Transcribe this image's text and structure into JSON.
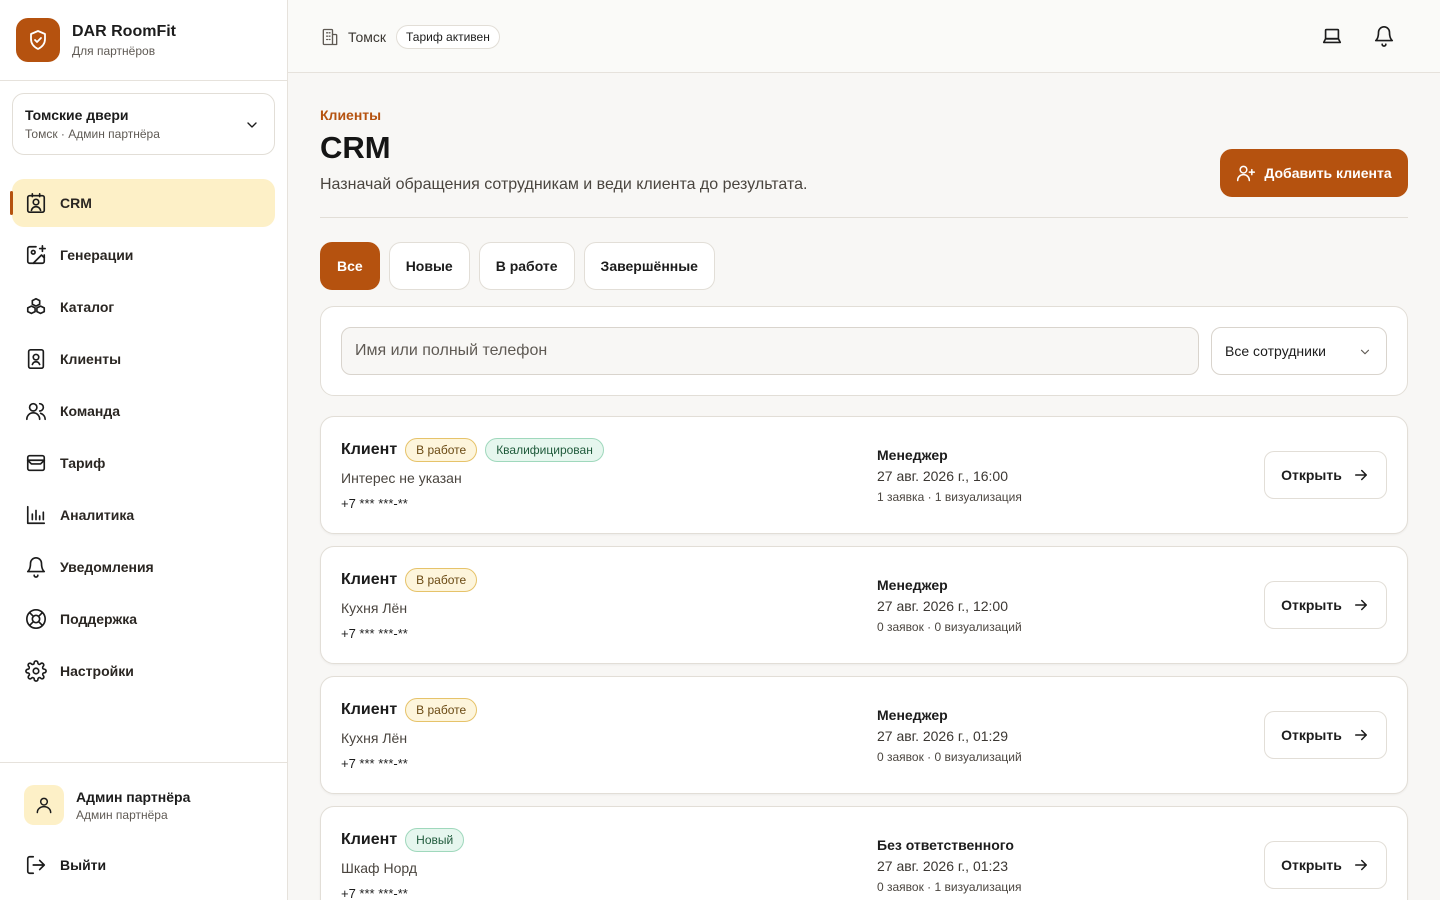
{
  "colors": {
    "accent": "#b5520f",
    "active_nav_bg": "#fdf0c7"
  },
  "brand": {
    "name": "DAR RoomFit",
    "subtitle": "Для партнёров"
  },
  "org": {
    "name": "Томские двери",
    "subtitle": "Томск · Админ партнёра"
  },
  "nav": [
    {
      "label": "CRM",
      "icon": "contact-icon",
      "active": true
    },
    {
      "label": "Генерации",
      "icon": "image-plus-icon"
    },
    {
      "label": "Каталог",
      "icon": "boxes-icon"
    },
    {
      "label": "Клиенты",
      "icon": "contact-book-icon"
    },
    {
      "label": "Команда",
      "icon": "users-icon"
    },
    {
      "label": "Тариф",
      "icon": "wallet-icon"
    },
    {
      "label": "Аналитика",
      "icon": "chart-icon"
    },
    {
      "label": "Уведомления",
      "icon": "bell-icon"
    },
    {
      "label": "Поддержка",
      "icon": "lifebuoy-icon"
    },
    {
      "label": "Настройки",
      "icon": "gear-icon"
    }
  ],
  "user": {
    "name": "Админ партнёра",
    "role": "Админ партнёра"
  },
  "logout_label": "Выйти",
  "topbar": {
    "city": "Томск",
    "plan_badge": "Тариф активен"
  },
  "page": {
    "breadcrumb": "Клиенты",
    "title": "CRM",
    "description": "Назначай обращения сотрудникам и веди клиента до результата.",
    "add_button": "Добавить клиента"
  },
  "tabs": [
    {
      "label": "Все",
      "active": true
    },
    {
      "label": "Новые"
    },
    {
      "label": "В работе"
    },
    {
      "label": "Завершённые"
    }
  ],
  "filters": {
    "search_placeholder": "Имя или полный телефон",
    "employee_select": "Все сотрудники"
  },
  "open_label": "Открыть",
  "clients": [
    {
      "name": "Клиент",
      "badges": [
        {
          "text": "В работе",
          "kind": "work"
        },
        {
          "text": "Квалифицирован",
          "kind": "qual"
        }
      ],
      "interest": "Интерес не указан",
      "phone": "+7 *** ***-**",
      "manager": "Менеджер",
      "date": "27 авг. 2026 г., 16:00",
      "stats": "1 заявка · 1 визуализация"
    },
    {
      "name": "Клиент",
      "badges": [
        {
          "text": "В работе",
          "kind": "work"
        }
      ],
      "interest": "Кухня Лён",
      "phone": "+7 *** ***-**",
      "manager": "Менеджер",
      "date": "27 авг. 2026 г., 12:00",
      "stats": "0 заявок · 0 визуализаций"
    },
    {
      "name": "Клиент",
      "badges": [
        {
          "text": "В работе",
          "kind": "work"
        }
      ],
      "interest": "Кухня Лён",
      "phone": "+7 *** ***-**",
      "manager": "Менеджер",
      "date": "27 авг. 2026 г., 01:29",
      "stats": "0 заявок · 0 визуализаций"
    },
    {
      "name": "Клиент",
      "badges": [
        {
          "text": "Новый",
          "kind": "new"
        }
      ],
      "interest": "Шкаф Норд",
      "phone": "+7 *** ***-**",
      "manager": "Без ответственного",
      "date": "27 авг. 2026 г., 01:23",
      "stats": "0 заявок · 1 визуализация"
    }
  ]
}
